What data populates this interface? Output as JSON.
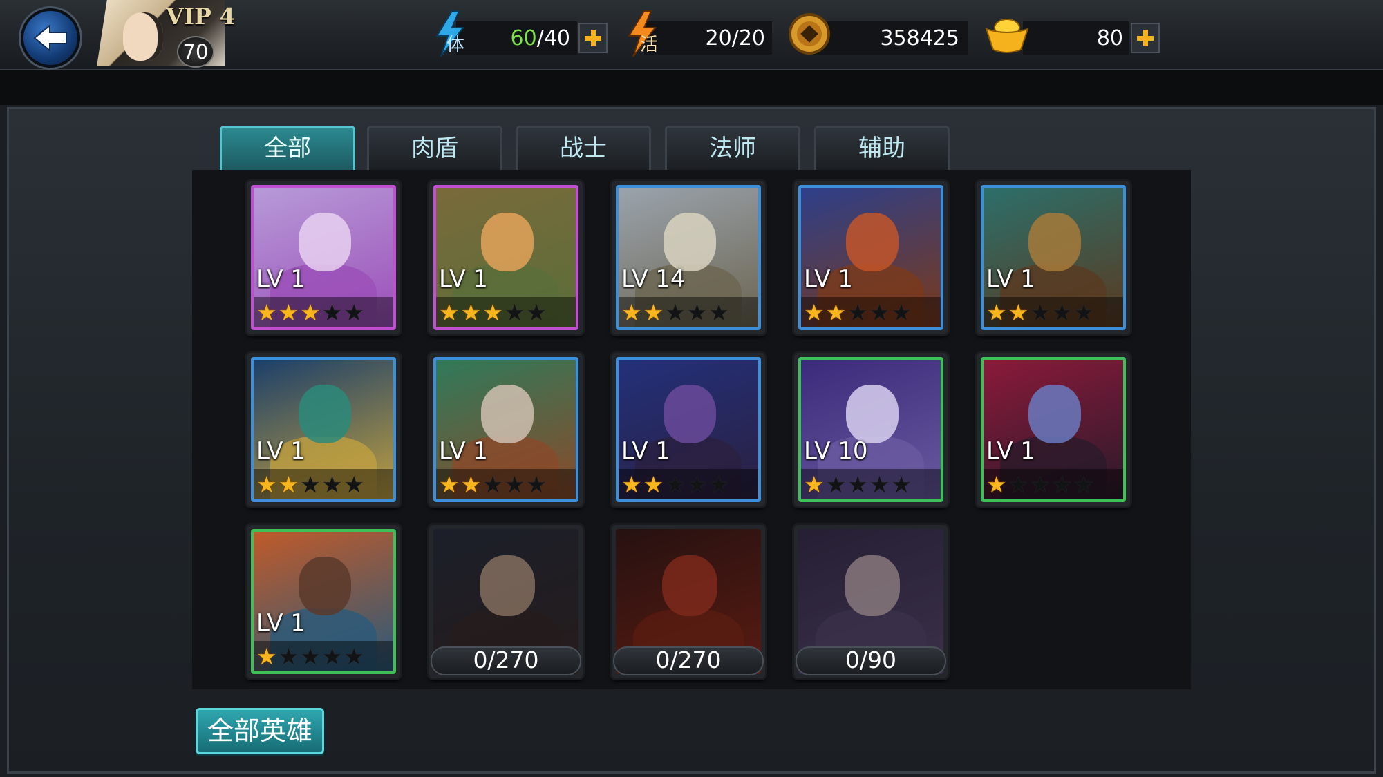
{
  "header": {
    "vip_label": "VIP 4",
    "player_level": "70",
    "stamina": {
      "current": "60",
      "max": "/40",
      "icon_label": "体"
    },
    "energy": {
      "current": "20",
      "max": "/20",
      "icon_label": "活"
    },
    "coins": "358425",
    "gold": "80"
  },
  "tabs": [
    "全部",
    "肉盾",
    "战士",
    "法师",
    "辅助"
  ],
  "active_tab": 0,
  "heroes": [
    {
      "level": "LV 1",
      "stars": 3,
      "frame": "#c04fd1",
      "palette": [
        "#b79ad8",
        "#e8d0f0",
        "#9b4fb8"
      ]
    },
    {
      "level": "LV 1",
      "stars": 3,
      "frame": "#c04fd1",
      "palette": [
        "#7a6a3a",
        "#e3a25a",
        "#5a6e3a"
      ]
    },
    {
      "level": "LV 14",
      "stars": 2,
      "frame": "#3d8fd9",
      "palette": [
        "#9aa3ad",
        "#d8d2c0",
        "#6c6550"
      ]
    },
    {
      "level": "LV 1",
      "stars": 2,
      "frame": "#3d8fd9",
      "palette": [
        "#2d3f8a",
        "#c2552a",
        "#7a3a1a"
      ]
    },
    {
      "level": "LV 1",
      "stars": 2,
      "frame": "#3d8fd9",
      "palette": [
        "#2c6f6a",
        "#a67a3a",
        "#5a3a20"
      ]
    },
    {
      "level": "LV 1",
      "stars": 2,
      "frame": "#3d8fd9",
      "palette": [
        "#1b3f6a",
        "#2b8a7a",
        "#c0a040"
      ]
    },
    {
      "level": "LV 1",
      "stars": 2,
      "frame": "#3d8fd9",
      "palette": [
        "#2f7a5a",
        "#d0c0b0",
        "#8a4a2a"
      ]
    },
    {
      "level": "LV 1",
      "stars": 2,
      "frame": "#3d8fd9",
      "palette": [
        "#23307a",
        "#6a4a9a",
        "#2a2040"
      ]
    },
    {
      "level": "LV 10",
      "stars": 1,
      "frame": "#3fbf58",
      "palette": [
        "#3a2a7a",
        "#d8d0f0",
        "#6a5aa0"
      ]
    },
    {
      "level": "LV 1",
      "stars": 1,
      "frame": "#3fbf58",
      "palette": [
        "#8a1a3a",
        "#6a7ac0",
        "#2a1a2a"
      ]
    },
    {
      "level": "LV 1",
      "stars": 1,
      "frame": "#3fbf58",
      "palette": [
        "#c05a2a",
        "#5a3a2a",
        "#2a5a7a"
      ]
    }
  ],
  "locked_heroes": [
    {
      "fragments": "0/270",
      "palette": [
        "#2a3040",
        "#c8a890",
        "#3a2a2a"
      ]
    },
    {
      "fragments": "0/270",
      "palette": [
        "#3a1a1a",
        "#c0402a",
        "#8a2a1a"
      ]
    },
    {
      "fragments": "0/90",
      "palette": [
        "#3a3050",
        "#d0b8c0",
        "#5a4a70"
      ]
    }
  ],
  "all_heroes_button": "全部英雄"
}
